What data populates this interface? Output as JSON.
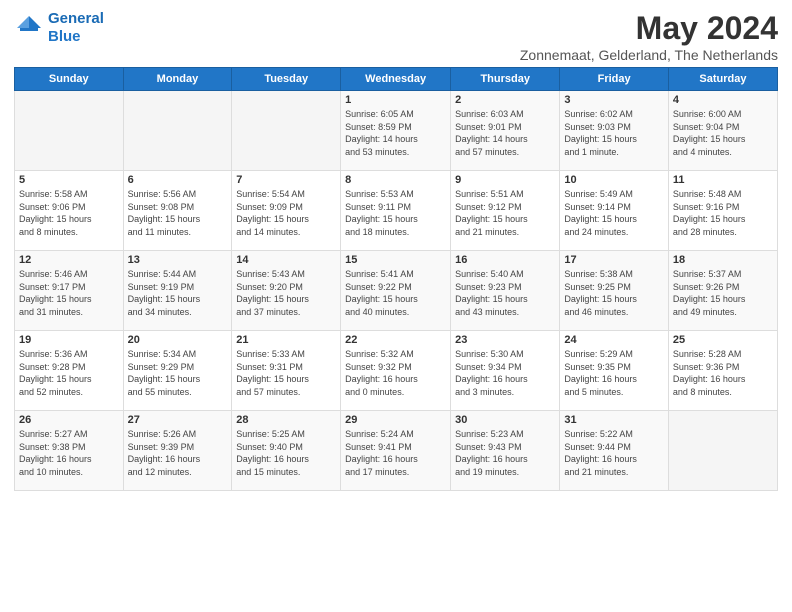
{
  "logo": {
    "line1": "General",
    "line2": "Blue"
  },
  "title": "May 2024",
  "subtitle": "Zonnemaat, Gelderland, The Netherlands",
  "weekdays": [
    "Sunday",
    "Monday",
    "Tuesday",
    "Wednesday",
    "Thursday",
    "Friday",
    "Saturday"
  ],
  "weeks": [
    [
      {
        "day": "",
        "info": ""
      },
      {
        "day": "",
        "info": ""
      },
      {
        "day": "",
        "info": ""
      },
      {
        "day": "1",
        "info": "Sunrise: 6:05 AM\nSunset: 8:59 PM\nDaylight: 14 hours\nand 53 minutes."
      },
      {
        "day": "2",
        "info": "Sunrise: 6:03 AM\nSunset: 9:01 PM\nDaylight: 14 hours\nand 57 minutes."
      },
      {
        "day": "3",
        "info": "Sunrise: 6:02 AM\nSunset: 9:03 PM\nDaylight: 15 hours\nand 1 minute."
      },
      {
        "day": "4",
        "info": "Sunrise: 6:00 AM\nSunset: 9:04 PM\nDaylight: 15 hours\nand 4 minutes."
      }
    ],
    [
      {
        "day": "5",
        "info": "Sunrise: 5:58 AM\nSunset: 9:06 PM\nDaylight: 15 hours\nand 8 minutes."
      },
      {
        "day": "6",
        "info": "Sunrise: 5:56 AM\nSunset: 9:08 PM\nDaylight: 15 hours\nand 11 minutes."
      },
      {
        "day": "7",
        "info": "Sunrise: 5:54 AM\nSunset: 9:09 PM\nDaylight: 15 hours\nand 14 minutes."
      },
      {
        "day": "8",
        "info": "Sunrise: 5:53 AM\nSunset: 9:11 PM\nDaylight: 15 hours\nand 18 minutes."
      },
      {
        "day": "9",
        "info": "Sunrise: 5:51 AM\nSunset: 9:12 PM\nDaylight: 15 hours\nand 21 minutes."
      },
      {
        "day": "10",
        "info": "Sunrise: 5:49 AM\nSunset: 9:14 PM\nDaylight: 15 hours\nand 24 minutes."
      },
      {
        "day": "11",
        "info": "Sunrise: 5:48 AM\nSunset: 9:16 PM\nDaylight: 15 hours\nand 28 minutes."
      }
    ],
    [
      {
        "day": "12",
        "info": "Sunrise: 5:46 AM\nSunset: 9:17 PM\nDaylight: 15 hours\nand 31 minutes."
      },
      {
        "day": "13",
        "info": "Sunrise: 5:44 AM\nSunset: 9:19 PM\nDaylight: 15 hours\nand 34 minutes."
      },
      {
        "day": "14",
        "info": "Sunrise: 5:43 AM\nSunset: 9:20 PM\nDaylight: 15 hours\nand 37 minutes."
      },
      {
        "day": "15",
        "info": "Sunrise: 5:41 AM\nSunset: 9:22 PM\nDaylight: 15 hours\nand 40 minutes."
      },
      {
        "day": "16",
        "info": "Sunrise: 5:40 AM\nSunset: 9:23 PM\nDaylight: 15 hours\nand 43 minutes."
      },
      {
        "day": "17",
        "info": "Sunrise: 5:38 AM\nSunset: 9:25 PM\nDaylight: 15 hours\nand 46 minutes."
      },
      {
        "day": "18",
        "info": "Sunrise: 5:37 AM\nSunset: 9:26 PM\nDaylight: 15 hours\nand 49 minutes."
      }
    ],
    [
      {
        "day": "19",
        "info": "Sunrise: 5:36 AM\nSunset: 9:28 PM\nDaylight: 15 hours\nand 52 minutes."
      },
      {
        "day": "20",
        "info": "Sunrise: 5:34 AM\nSunset: 9:29 PM\nDaylight: 15 hours\nand 55 minutes."
      },
      {
        "day": "21",
        "info": "Sunrise: 5:33 AM\nSunset: 9:31 PM\nDaylight: 15 hours\nand 57 minutes."
      },
      {
        "day": "22",
        "info": "Sunrise: 5:32 AM\nSunset: 9:32 PM\nDaylight: 16 hours\nand 0 minutes."
      },
      {
        "day": "23",
        "info": "Sunrise: 5:30 AM\nSunset: 9:34 PM\nDaylight: 16 hours\nand 3 minutes."
      },
      {
        "day": "24",
        "info": "Sunrise: 5:29 AM\nSunset: 9:35 PM\nDaylight: 16 hours\nand 5 minutes."
      },
      {
        "day": "25",
        "info": "Sunrise: 5:28 AM\nSunset: 9:36 PM\nDaylight: 16 hours\nand 8 minutes."
      }
    ],
    [
      {
        "day": "26",
        "info": "Sunrise: 5:27 AM\nSunset: 9:38 PM\nDaylight: 16 hours\nand 10 minutes."
      },
      {
        "day": "27",
        "info": "Sunrise: 5:26 AM\nSunset: 9:39 PM\nDaylight: 16 hours\nand 12 minutes."
      },
      {
        "day": "28",
        "info": "Sunrise: 5:25 AM\nSunset: 9:40 PM\nDaylight: 16 hours\nand 15 minutes."
      },
      {
        "day": "29",
        "info": "Sunrise: 5:24 AM\nSunset: 9:41 PM\nDaylight: 16 hours\nand 17 minutes."
      },
      {
        "day": "30",
        "info": "Sunrise: 5:23 AM\nSunset: 9:43 PM\nDaylight: 16 hours\nand 19 minutes."
      },
      {
        "day": "31",
        "info": "Sunrise: 5:22 AM\nSunset: 9:44 PM\nDaylight: 16 hours\nand 21 minutes."
      },
      {
        "day": "",
        "info": ""
      }
    ]
  ]
}
